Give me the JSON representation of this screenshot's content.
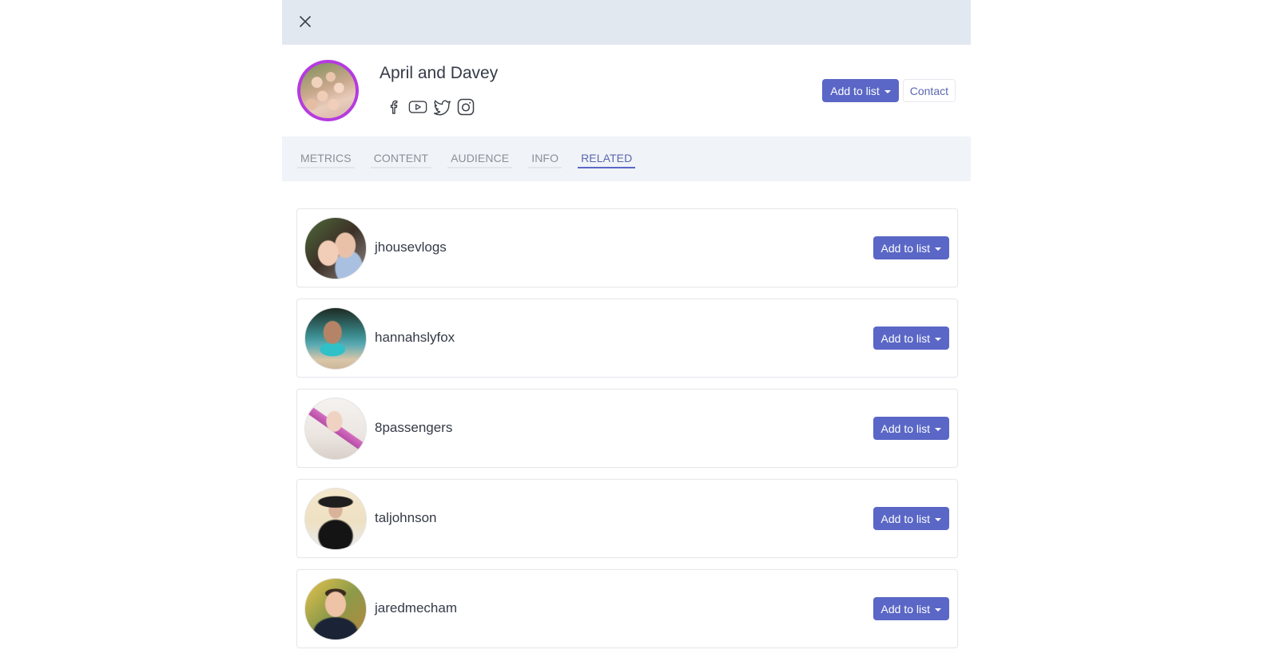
{
  "header": {
    "close_label": "close",
    "profile_name": "April and Davey",
    "social_icons": [
      "facebook-icon",
      "youtube-icon",
      "twitter-icon",
      "instagram-icon"
    ],
    "add_to_list_label": "Add to list",
    "contact_label": "Contact"
  },
  "tabs": [
    {
      "label": "METRICS",
      "active": false
    },
    {
      "label": "CONTENT",
      "active": false
    },
    {
      "label": "AUDIENCE",
      "active": false
    },
    {
      "label": "INFO",
      "active": false
    },
    {
      "label": "RELATED",
      "active": true
    }
  ],
  "related": [
    {
      "username": "jhousevlogs",
      "button_label": "Add to list"
    },
    {
      "username": "hannahslyfox",
      "button_label": "Add to list"
    },
    {
      "username": "8passengers",
      "button_label": "Add to list"
    },
    {
      "username": "taljohnson",
      "button_label": "Add to list"
    },
    {
      "username": "jaredmecham",
      "button_label": "Add to list"
    }
  ],
  "colors": {
    "accent": "#5a67c6",
    "topbar": "#e1e8f0",
    "tabbar": "#f0f3f7",
    "avatar_ring": "#b43be0"
  }
}
